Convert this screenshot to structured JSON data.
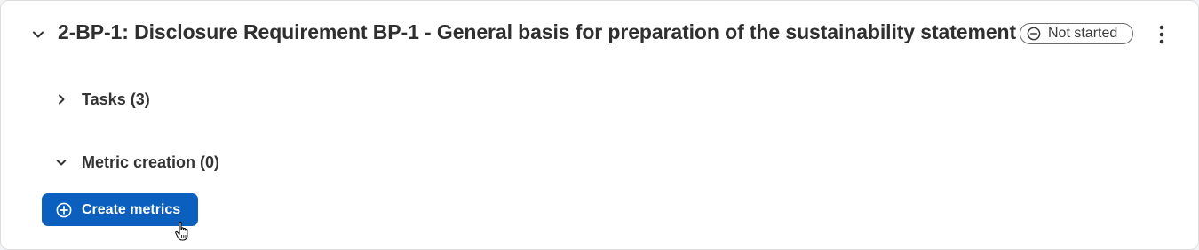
{
  "requirement": {
    "title": "2-BP-1: Disclosure Requirement BP-1 - General basis for preparation of the sustainability statement",
    "status": "Not started",
    "expanded": true
  },
  "sections": {
    "tasks": {
      "label": "Tasks (3)",
      "expanded": false
    },
    "metric_creation": {
      "label": "Metric creation (0)",
      "expanded": true
    }
  },
  "actions": {
    "create_metrics_label": "Create metrics"
  },
  "icons": {
    "collapse": "chevron-down-icon",
    "status": "minus-circle-icon",
    "more": "vertical-ellipsis-icon",
    "tasks_toggle": "chevron-right-icon",
    "metric_toggle": "chevron-down-icon",
    "create": "plus-circle-icon",
    "pointer": "hand-pointer-icon"
  },
  "colors": {
    "primary": "#0a5fbf",
    "text": "#2f2f2f",
    "border": "#dcdcdc"
  }
}
